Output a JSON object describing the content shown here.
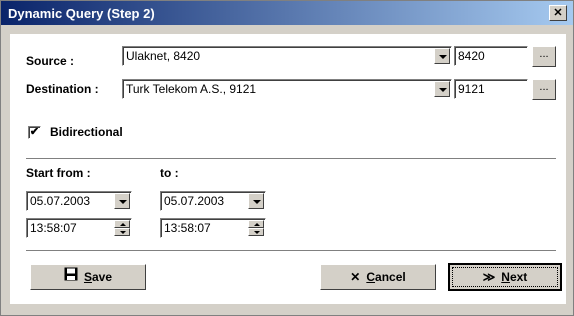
{
  "window": {
    "title": "Dynamic Query (Step 2)",
    "close_glyph": "✕"
  },
  "source": {
    "label": "Source :",
    "value": "Ulaknet, 8420",
    "code": "8420",
    "browse_label": "..."
  },
  "destination": {
    "label": "Destination :",
    "value": "Turk Telekom A.S., 9121",
    "code": "9121",
    "browse_label": "..."
  },
  "bidirectional": {
    "label": "Bidirectional",
    "checked": true,
    "check_glyph": "✔"
  },
  "start": {
    "label": "Start from :",
    "date": "05.07.2003",
    "time": "13:58:07"
  },
  "end": {
    "label": "to :",
    "date": "05.07.2003",
    "time": "13:58:07"
  },
  "buttons": {
    "save": {
      "mnemonic": "S",
      "rest": "ave",
      "icon": "floppy-icon"
    },
    "cancel": {
      "mnemonic": "C",
      "rest": "ancel",
      "icon": "x-icon",
      "glyph": "✕"
    },
    "next": {
      "mnemonic": "N",
      "rest": "ext",
      "icon": "double-chevron-icon",
      "glyph": "≫"
    }
  }
}
